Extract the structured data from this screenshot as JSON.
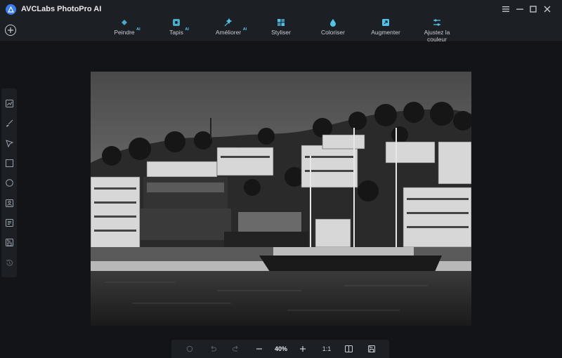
{
  "app": {
    "title": "AVCLabs PhotoPro AI"
  },
  "toolbar": {
    "items": [
      {
        "label": "Peindre",
        "badge": "AI",
        "icon": "paint-bucket-icon"
      },
      {
        "label": "Tapis",
        "badge": "AI",
        "icon": "patch-icon"
      },
      {
        "label": "Améliorer",
        "badge": "AI",
        "icon": "enhance-icon"
      },
      {
        "label": "Styliser",
        "badge": "",
        "icon": "stylize-icon"
      },
      {
        "label": "Coloriser",
        "badge": "",
        "icon": "colorize-icon"
      },
      {
        "label": "Augmenter",
        "badge": "",
        "icon": "upscale-icon"
      },
      {
        "label": "Ajustez la couleur",
        "badge": "",
        "icon": "adjust-color-icon"
      }
    ]
  },
  "sidebar": {
    "tools": [
      "compare-icon",
      "brush-icon",
      "select-arrow-icon",
      "rectangle-select-icon",
      "ellipse-select-icon",
      "person-select-icon",
      "text-select-icon",
      "save-layer-icon",
      "history-icon"
    ]
  },
  "bottombar": {
    "zoom": "40%",
    "ratio": "1:1"
  },
  "colors": {
    "accent": "#4fc3e8",
    "brand": "#3b7df0",
    "background": "#121417",
    "panel": "#1c1f24"
  }
}
